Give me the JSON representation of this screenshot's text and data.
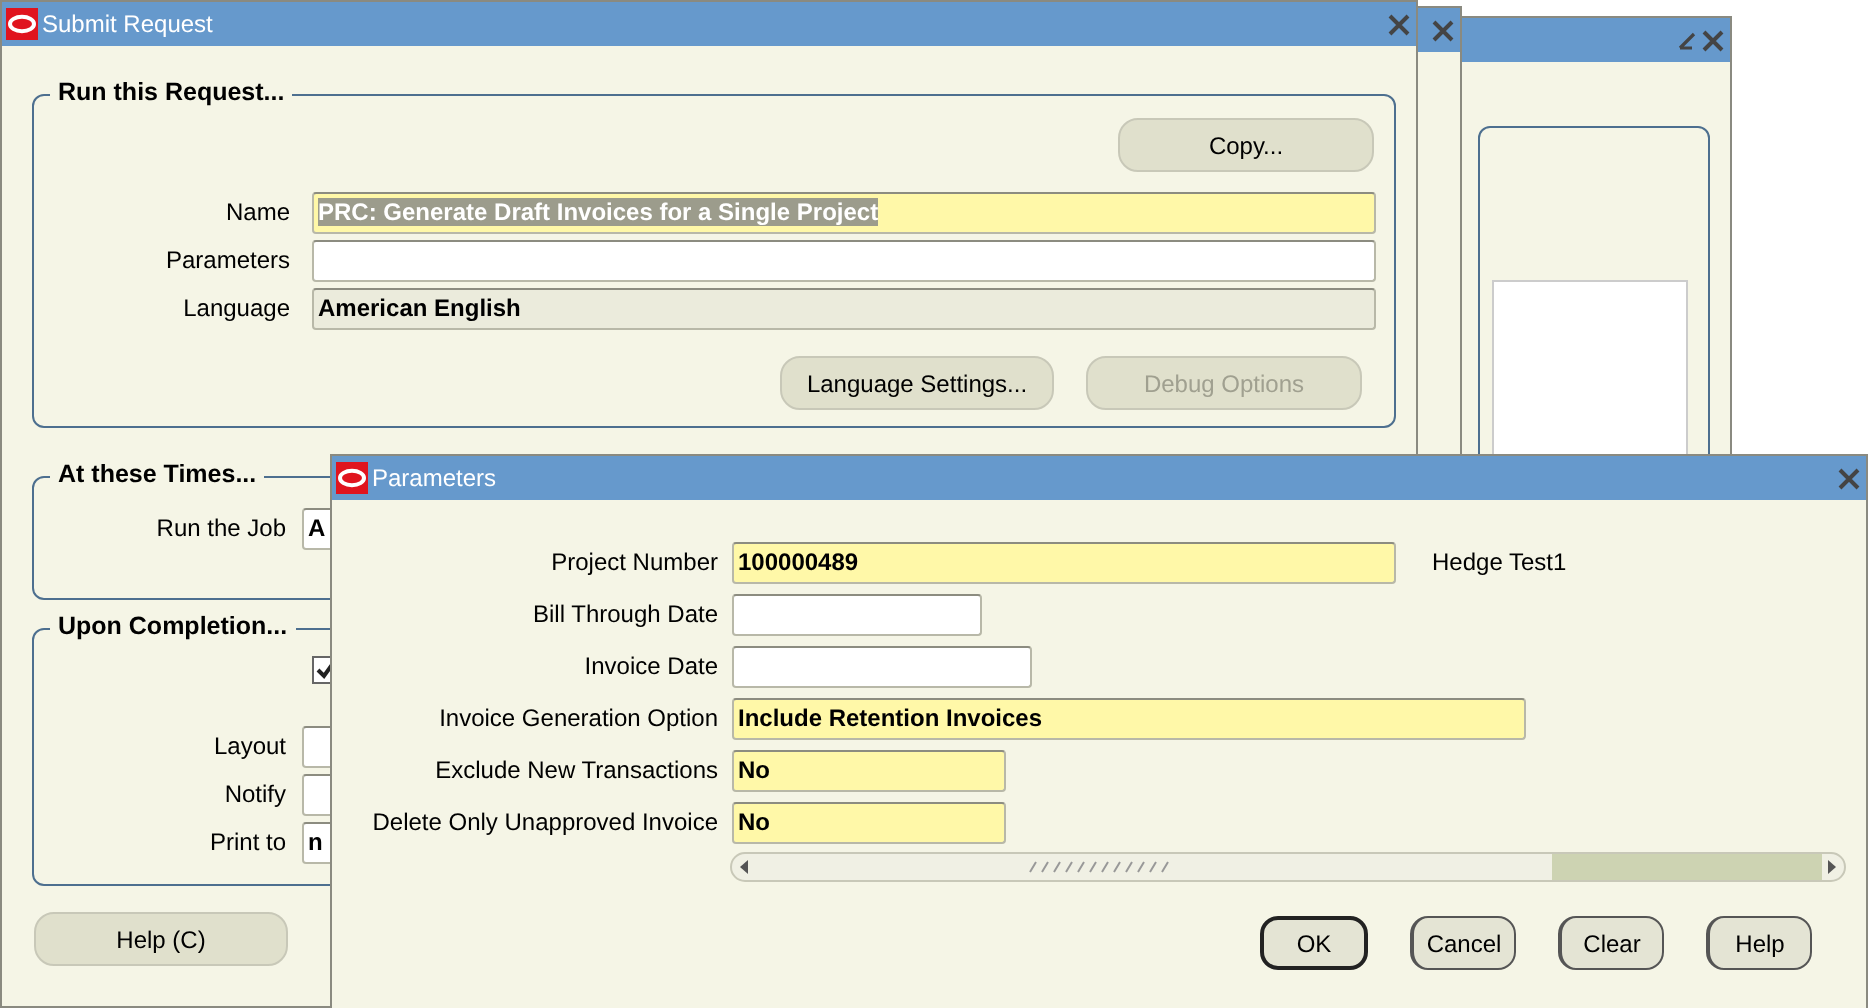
{
  "submit_window": {
    "title": "Submit Request",
    "run_group": {
      "title": "Run this Request...",
      "copy_button": "Copy...",
      "fields": [
        {
          "label": "Name",
          "value": "PRC: Generate Draft Invoices for a Single Project",
          "required": true,
          "selected": true
        },
        {
          "label": "Parameters",
          "required": false
        },
        {
          "label": "Language",
          "value": "American English",
          "required": false,
          "readonly": true
        }
      ],
      "buttons": [
        {
          "label": "Language Settings...",
          "disabled": false
        },
        {
          "label": "Debug Options",
          "disabled": true
        }
      ]
    },
    "times_group": {
      "title": "At these Times...",
      "label": "Run the Job",
      "value": "A"
    },
    "completion_group": {
      "title": "Upon Completion...",
      "checked": true,
      "fields": [
        {
          "label": "Layout"
        },
        {
          "label": "Notify"
        },
        {
          "label": "Print to",
          "value": "n"
        }
      ]
    },
    "help_button": "Help (C)"
  },
  "parameters_window": {
    "title": "Parameters",
    "fields": [
      {
        "label": "Project Number",
        "value": "100000489",
        "required": true,
        "description": "Hedge Test1"
      },
      {
        "label": "Bill Through Date",
        "required": false
      },
      {
        "label": "Invoice Date",
        "required": false
      },
      {
        "label": "Invoice Generation Option",
        "value": "Include Retention Invoices",
        "required": true
      },
      {
        "label": "Exclude New Transactions",
        "value": "No",
        "required": true
      },
      {
        "label": "Delete Only Unapproved Invoice",
        "value": "No",
        "required": true
      }
    ],
    "buttons": [
      {
        "label": "OK",
        "default": true
      },
      {
        "label": "Cancel",
        "default": false
      },
      {
        "label": "Clear",
        "default": false
      },
      {
        "label": "Help",
        "default": false
      }
    ]
  }
}
